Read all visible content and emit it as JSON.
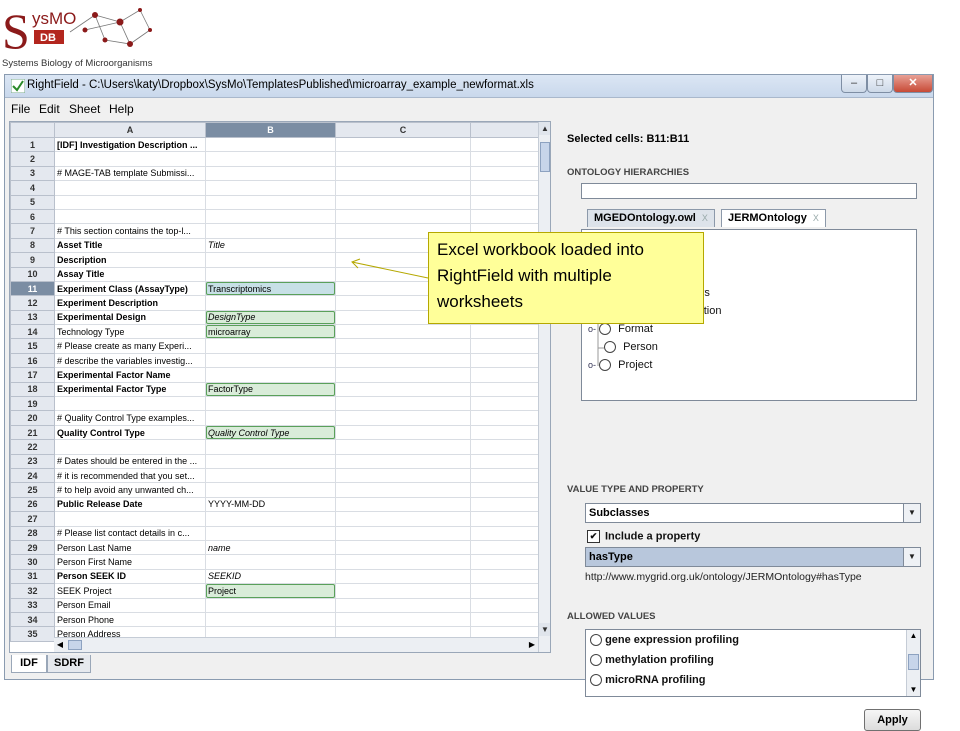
{
  "logo": {
    "brand": "SysMO",
    "db": "DB",
    "tagline": "Systems Biology of Microorganisms"
  },
  "window": {
    "title": "RightField - C:\\Users\\katy\\Dropbox\\SysMo\\TemplatesPublished\\microarray_example_newformat.xls",
    "min": "▭",
    "max": "▢",
    "close": "x"
  },
  "menu": [
    "File",
    "Edit",
    "Sheet",
    "Help"
  ],
  "sheet": {
    "columns": [
      "A",
      "B",
      "C"
    ],
    "selected_column": "B",
    "rows": [
      {
        "n": "1",
        "a": "[IDF] Investigation Description ...",
        "b": "",
        "ab": true
      },
      {
        "n": "2",
        "a": "",
        "b": ""
      },
      {
        "n": "3",
        "a": "# MAGE-TAB template Submissi...",
        "b": ""
      },
      {
        "n": "4",
        "a": "",
        "b": ""
      },
      {
        "n": "5",
        "a": "",
        "b": ""
      },
      {
        "n": "6",
        "a": "",
        "b": ""
      },
      {
        "n": "7",
        "a": "# This section contains the top-l...",
        "b": ""
      },
      {
        "n": "8",
        "a": "Asset Title",
        "b": "Title",
        "ab": true,
        "bi": true
      },
      {
        "n": "9",
        "a": "Description",
        "b": "",
        "ab": true
      },
      {
        "n": "10",
        "a": "Assay Title",
        "b": "",
        "ab": true
      },
      {
        "n": "11",
        "a": "Experiment Class (AssayType)",
        "b": "Transcriptomics",
        "ab": true,
        "bv": true,
        "sel": true
      },
      {
        "n": "12",
        "a": "Experiment Description",
        "b": "",
        "ab": true
      },
      {
        "n": "13",
        "a": "Experimental Design",
        "b": "DesignType",
        "ab": true,
        "bv": true,
        "bi": true
      },
      {
        "n": "14",
        "a": "Technology Type",
        "b": "microarray",
        "bv": true
      },
      {
        "n": "15",
        "a": "# Please create as many Experi...",
        "b": ""
      },
      {
        "n": "16",
        "a": "# describe the variables investig...",
        "b": ""
      },
      {
        "n": "17",
        "a": "Experimental Factor Name",
        "b": "",
        "ab": true
      },
      {
        "n": "18",
        "a": "Experimental Factor Type",
        "b": "FactorType",
        "ab": true,
        "bv": true
      },
      {
        "n": "19",
        "a": "",
        "b": ""
      },
      {
        "n": "20",
        "a": "# Quality Control Type examples...",
        "b": ""
      },
      {
        "n": "21",
        "a": "Quality Control Type",
        "b": "Quality Control Type",
        "ab": true,
        "bv": true,
        "bi": true
      },
      {
        "n": "22",
        "a": "",
        "b": ""
      },
      {
        "n": "23",
        "a": "# Dates should be entered in the ...",
        "b": ""
      },
      {
        "n": "24",
        "a": "# it is recommended that you set...",
        "b": ""
      },
      {
        "n": "25",
        "a": "# to help avoid any unwanted ch...",
        "b": ""
      },
      {
        "n": "26",
        "a": "Public Release Date",
        "b": "YYYY-MM-DD",
        "ab": true
      },
      {
        "n": "27",
        "a": "",
        "b": ""
      },
      {
        "n": "28",
        "a": "# Please list contact details in c...",
        "b": ""
      },
      {
        "n": "29",
        "a": "Person Last Name",
        "b": "name",
        "bi": true
      },
      {
        "n": "30",
        "a": "Person First Name",
        "b": ""
      },
      {
        "n": "31",
        "a": "Person SEEK ID",
        "b": "SEEKID",
        "ab": true,
        "bi": true
      },
      {
        "n": "32",
        "a": "SEEK Project",
        "b": "Project",
        "bv": true
      },
      {
        "n": "33",
        "a": "Person Email",
        "b": ""
      },
      {
        "n": "34",
        "a": "Person Phone",
        "b": ""
      },
      {
        "n": "35",
        "a": "Person Address",
        "b": ""
      }
    ],
    "tabs": [
      "IDF",
      "SDRF"
    ],
    "active_tab": "IDF"
  },
  "right": {
    "selected_cells": "Selected cells: B11:B11",
    "ontology_hierarchies_label": "ONTOLOGY HIERARCHIES",
    "search_value": "",
    "ontology_tabs": [
      {
        "label": "MGEDOntology.owl",
        "close": "X"
      },
      {
        "label": "JERMOntology",
        "close": "X"
      }
    ],
    "active_ontology_tab": "JERMOntology",
    "tree_partial": [
      "ctors",
      "cription"
    ],
    "tree_nodes": [
      "Format",
      "Person",
      "Project"
    ],
    "value_type_label": "VALUE TYPE AND PROPERTY",
    "value_type": "Subclasses",
    "include_property_label": "Include a property",
    "include_property_checked": "✔",
    "property": "hasType",
    "property_uri": "http://www.mygrid.org.uk/ontology/JERMOntology#hasType",
    "allowed_values_label": "ALLOWED VALUES",
    "allowed_values": [
      "gene expression profiling",
      "methylation profiling",
      "microRNA profiling"
    ],
    "apply_label": "Apply"
  },
  "callout": {
    "text": "Excel workbook loaded into RightField with multiple worksheets",
    "color": "#ffff99"
  },
  "colors": {
    "selected_header": "#7b8da3",
    "validated_cell": "#d9ecd9",
    "validated_border": "#5aa05a"
  }
}
